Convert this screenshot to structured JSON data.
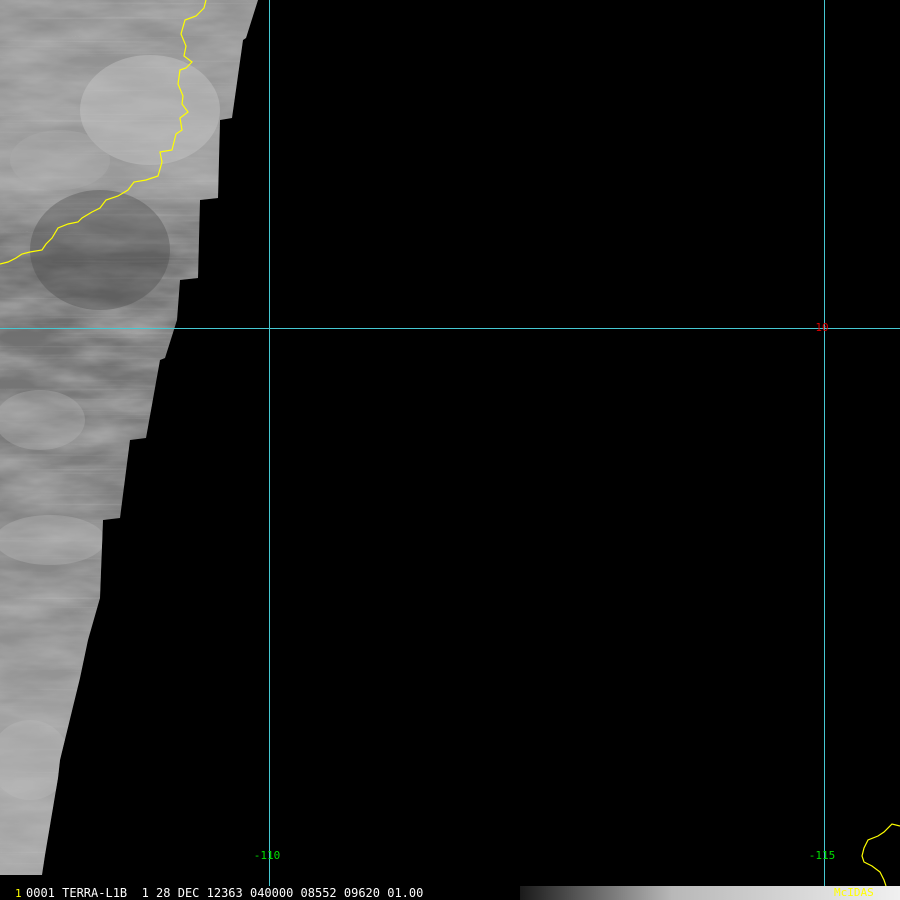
{
  "colors": {
    "background": "#000000",
    "grid_line": "#46c8d2",
    "coastline": "#ffff00",
    "longitude_label": "#00e000",
    "latitude_label": "#e00000",
    "status_text": "#ffffff",
    "frame_number": "#ffff00",
    "brand": "#ffff00"
  },
  "map": {
    "longitude_labels": [
      "-110",
      "-115"
    ],
    "latitude_labels": [
      "10"
    ]
  },
  "status_bar": {
    "frame_number": "1",
    "text": "0001 TERRA-L1B  1 28 DEC 12363 040000 08552 09620 01.00",
    "brand": "McIDAS"
  }
}
